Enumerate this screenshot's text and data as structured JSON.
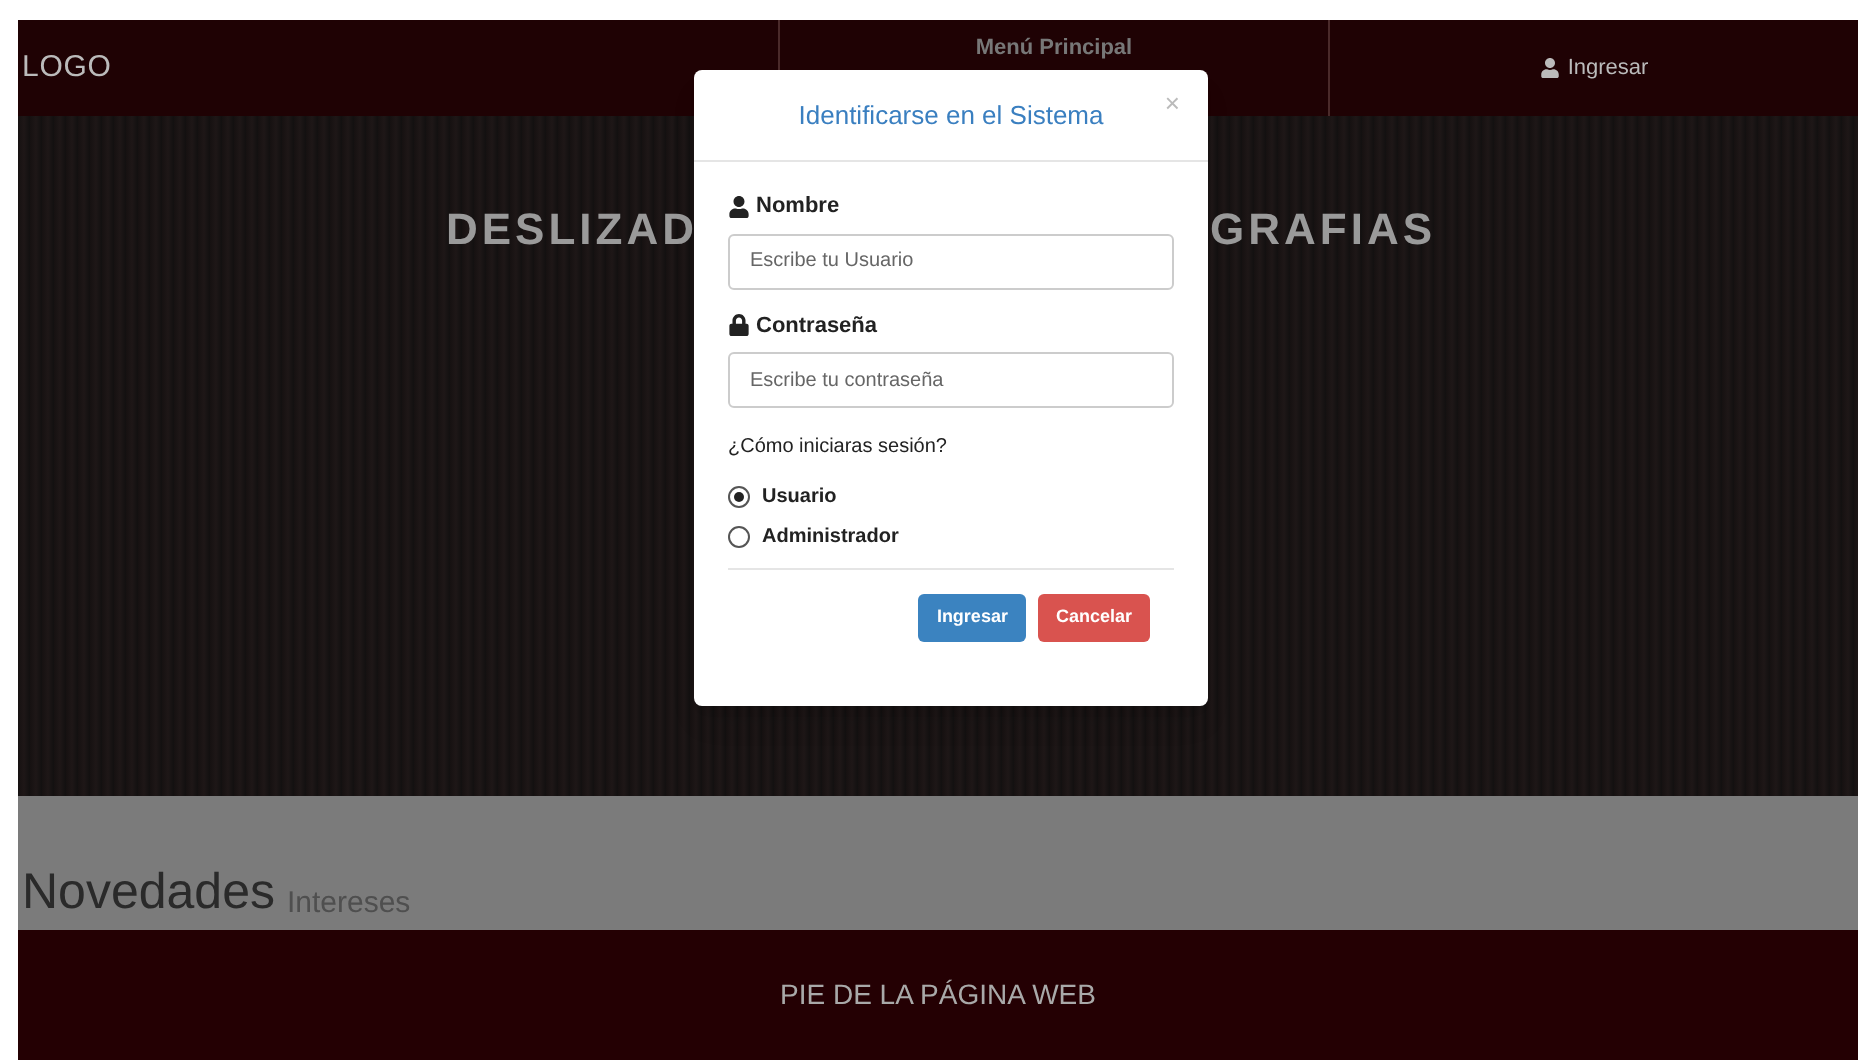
{
  "header": {
    "logo": "LOGO",
    "menu": "Menú Principal",
    "login": "Ingresar"
  },
  "slider": {
    "title_left": "DESLIZAD",
    "title_right": "GRAFIAS"
  },
  "news": {
    "title": "Novedades",
    "subtitle": "Intereses"
  },
  "footer": "PIE DE LA PÁGINA WEB",
  "modal": {
    "title": "Identificarse en el Sistema",
    "close": "×",
    "fields": [
      {
        "kind": "user",
        "label": "Nombre",
        "placeholder": "Escribe tu Usuario"
      },
      {
        "kind": "lock",
        "label": "Contraseña",
        "placeholder": "Escribe tu contraseña"
      }
    ],
    "question": "¿Cómo iniciaras sesión?",
    "options": [
      {
        "label": "Usuario",
        "selected": true
      },
      {
        "label": "Administrador",
        "selected": false
      }
    ],
    "buttons": [
      {
        "kind": "primary",
        "label": "Ingresar"
      },
      {
        "kind": "danger",
        "label": "Cancelar"
      }
    ]
  }
}
